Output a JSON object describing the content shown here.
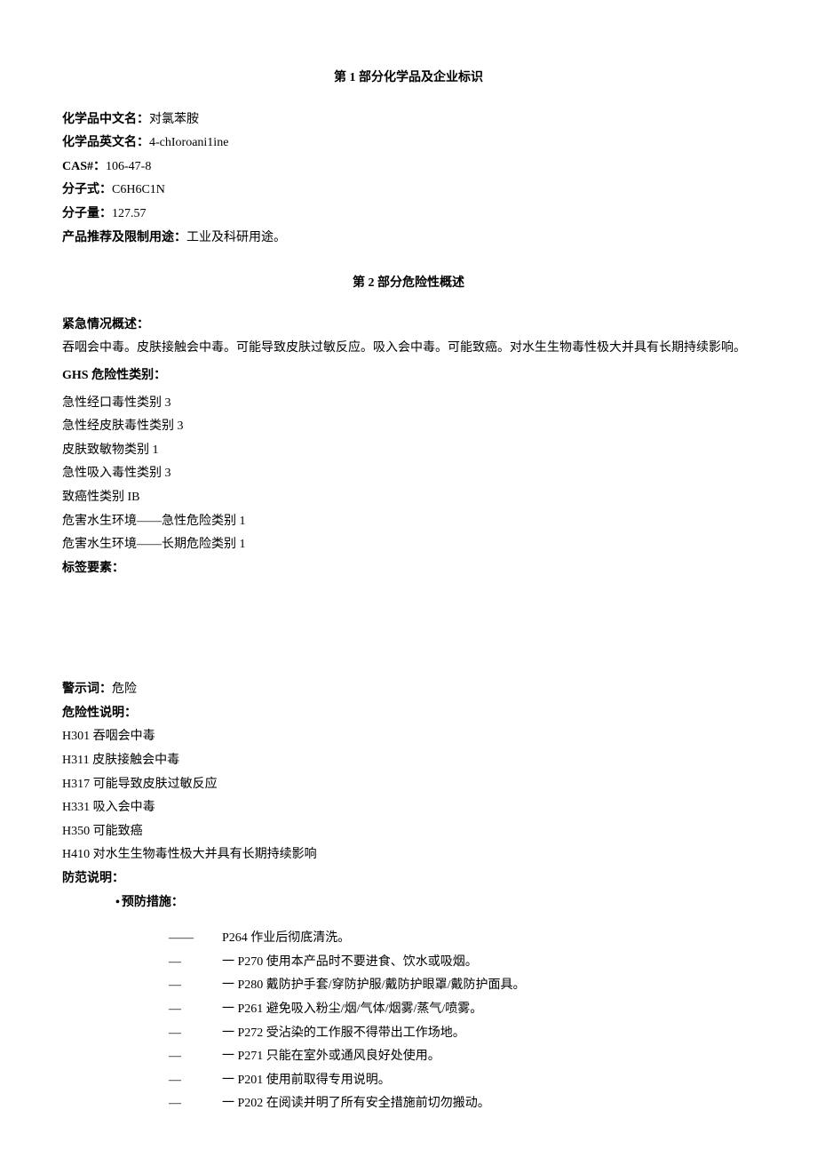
{
  "section1": {
    "title": "第 1 部分化学品及企业标识",
    "chineseName": {
      "label": "化学品中文名：",
      "value": "对氯苯胺"
    },
    "englishName": {
      "label": "化学品英文名：",
      "value": "4-chIoroani1ine"
    },
    "cas": {
      "label": "CAS#：",
      "value": "106-47-8"
    },
    "formula": {
      "label": "分子式：",
      "value": "C6H6C1N"
    },
    "weight": {
      "label": "分子量：",
      "value": "127.57"
    },
    "usage": {
      "label": "产品推荐及限制用途：",
      "value": "工业及科研用途。"
    }
  },
  "section2": {
    "title": "第 2 部分危险性概述",
    "emergency": {
      "label": "紧急情况概述：",
      "text": "吞咽会中毒。皮肤接触会中毒。可能导致皮肤过敏反应。吸入会中毒。可能致癌。对水生生物毒性极大并具有长期持续影响。"
    },
    "ghs": {
      "label": "GHS 危险性类别：",
      "items": [
        "急性经口毒性类别 3",
        "急性经皮肤毒性类别 3",
        "皮肤致敏物类别 1",
        "急性吸入毒性类别 3",
        "致癌性类别 IB",
        "危害水生环境——急性危险类别 1",
        "危害水生环境——长期危险类别 1"
      ]
    },
    "labelElements": {
      "label": "标签要素："
    },
    "signalWord": {
      "label": "警示词：",
      "value": "危险"
    },
    "hazardStatements": {
      "label": "危险性说明：",
      "items": [
        "H301 吞咽会中毒",
        "H311 皮肤接触会中毒",
        "H317 可能导致皮肤过敏反应",
        "H331 吸入会中毒",
        "H350 可能致癌",
        "H410 对水生生物毒性极大并具有长期持续影响"
      ]
    },
    "precautionary": {
      "label": "防范说明：",
      "preventLabel": "预防措施：",
      "items": [
        {
          "lead": "——",
          "text": "P264 作业后彻底清洗。"
        },
        {
          "lead": "—",
          "text": "一 P270 使用本产品时不要进食、饮水或吸烟。"
        },
        {
          "lead": "—",
          "text": "一 P280 戴防护手套/穿防护服/戴防护眼罩/戴防护面具。"
        },
        {
          "lead": "—",
          "text": "一 P261 避免吸入粉尘/烟/气体/烟雾/蒸气/喷雾。"
        },
        {
          "lead": "—",
          "text": "一 P272 受沾染的工作服不得带出工作场地。"
        },
        {
          "lead": "—",
          "text": "一 P271 只能在室外或通风良好处使用。"
        },
        {
          "lead": "—",
          "text": "一 P201 使用前取得专用说明。"
        },
        {
          "lead": "—",
          "text": "一 P202 在阅读并明了所有安全措施前切勿搬动。"
        }
      ]
    }
  }
}
